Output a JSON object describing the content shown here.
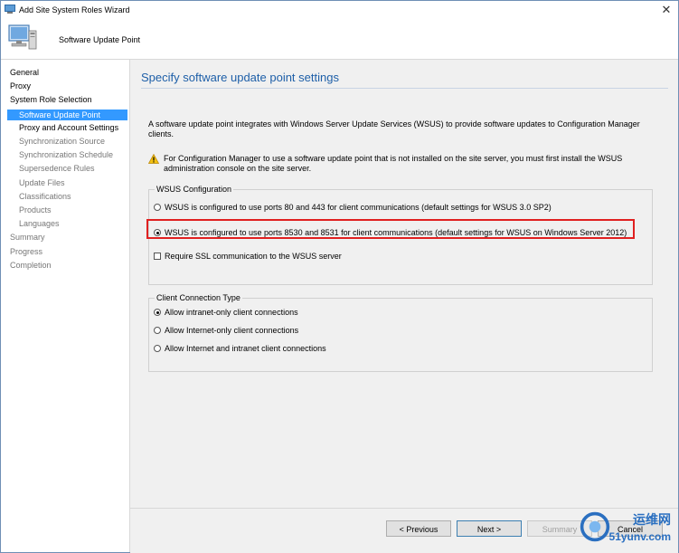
{
  "window": {
    "title": "Add Site System Roles Wizard",
    "close_label": "✕"
  },
  "header": {
    "subtitle": "Software Update Point"
  },
  "nav": {
    "items": [
      {
        "label": "General",
        "level": 0,
        "state": "normal"
      },
      {
        "label": "Proxy",
        "level": 0,
        "state": "normal"
      },
      {
        "label": "System Role Selection",
        "level": 0,
        "state": "normal"
      },
      {
        "label": "Software Update Point",
        "level": 1,
        "state": "selected"
      },
      {
        "label": "Proxy and Account Settings",
        "level": 1,
        "state": "enabled"
      },
      {
        "label": "Synchronization Source",
        "level": 1,
        "state": "gray"
      },
      {
        "label": "Synchronization Schedule",
        "level": 1,
        "state": "gray"
      },
      {
        "label": "Supersedence Rules",
        "level": 1,
        "state": "gray"
      },
      {
        "label": "Update Files",
        "level": 1,
        "state": "gray"
      },
      {
        "label": "Classifications",
        "level": 1,
        "state": "gray"
      },
      {
        "label": "Products",
        "level": 1,
        "state": "gray"
      },
      {
        "label": "Languages",
        "level": 1,
        "state": "gray"
      },
      {
        "label": "Summary",
        "level": 0,
        "state": "gray"
      },
      {
        "label": "Progress",
        "level": 0,
        "state": "gray"
      },
      {
        "label": "Completion",
        "level": 0,
        "state": "gray"
      }
    ]
  },
  "main": {
    "heading": "Specify software update point settings",
    "description": "A software update point integrates with Windows Server Update Services (WSUS) to provide software updates to Configuration Manager clients.",
    "warning": "For Configuration Manager to use a software update point that is not installed on the site server, you must first install the WSUS administration console on the site server.",
    "wsus_group": {
      "legend": "WSUS Configuration",
      "option_80": "WSUS is configured to use ports 80 and 443 for client communications (default settings for WSUS 3.0 SP2)",
      "option_8530": "WSUS is configured to use ports 8530 and 8531 for client communications (default settings for WSUS on Windows Server 2012)",
      "ssl_label": "Require SSL communication to the WSUS server"
    },
    "client_group": {
      "legend": "Client Connection Type",
      "intranet": "Allow intranet-only client connections",
      "internet": "Allow Internet-only client connections",
      "both": "Allow Internet and intranet client connections"
    }
  },
  "footer": {
    "previous": "< Previous",
    "next": "Next >",
    "summary": "Summary",
    "cancel": "Cancel"
  },
  "watermark": {
    "text": "运维网",
    "sub": "51yunv.com"
  },
  "colors": {
    "accent": "#3399ff",
    "heading": "#1e5fa8",
    "highlight": "#e02020"
  }
}
